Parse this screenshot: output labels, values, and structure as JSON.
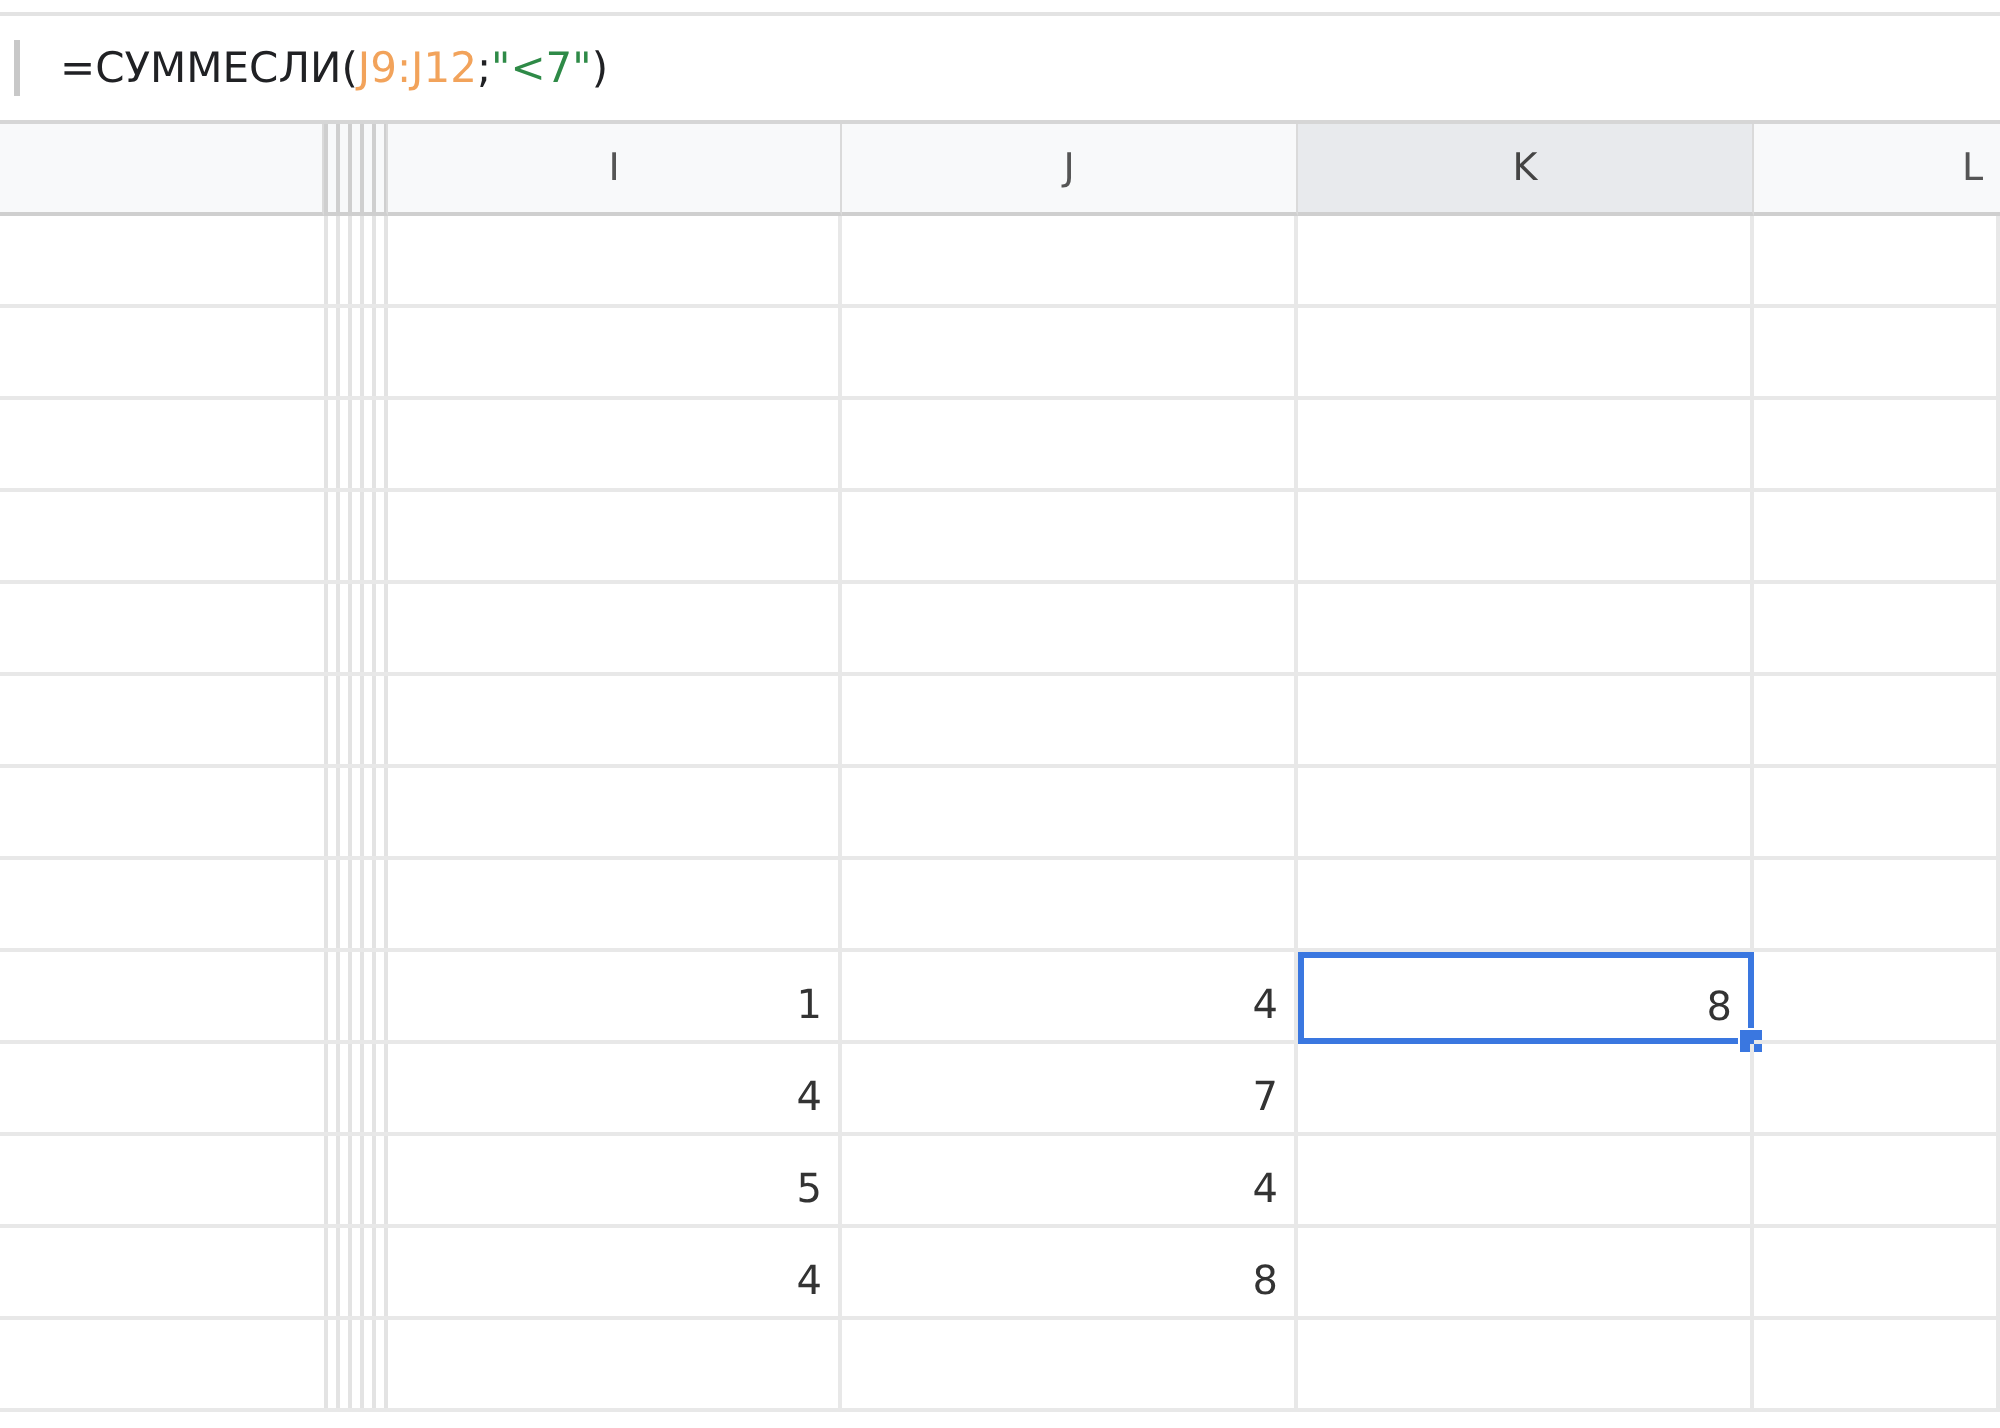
{
  "formula_bar": {
    "tokens": [
      {
        "text": "=СУММЕСЛИ(",
        "kind": "plain"
      },
      {
        "text": "J9:J12",
        "kind": "range"
      },
      {
        "text": ";",
        "kind": "plain"
      },
      {
        "text": "\"<7\"",
        "kind": "string"
      },
      {
        "text": ")",
        "kind": "plain"
      }
    ]
  },
  "columns": [
    {
      "label": "I",
      "selected": false
    },
    {
      "label": "J",
      "selected": false
    },
    {
      "label": "K",
      "selected": true
    },
    {
      "label": "L",
      "selected": false
    }
  ],
  "rows": [
    {
      "cells": [
        {
          "value": "1",
          "selected": false
        },
        {
          "value": "4",
          "selected": false
        },
        {
          "value": "8",
          "selected": true
        }
      ]
    },
    {
      "cells": [
        {
          "value": "4",
          "selected": false
        },
        {
          "value": "7",
          "selected": false
        },
        {
          "selected": false
        }
      ]
    },
    {
      "cells": [
        {
          "value": "5",
          "selected": false
        },
        {
          "value": "4",
          "selected": false
        },
        {
          "selected": false
        }
      ]
    },
    {
      "cells": [
        {
          "value": "4",
          "selected": false
        },
        {
          "value": "8",
          "selected": false
        },
        {
          "selected": false
        }
      ]
    }
  ]
}
